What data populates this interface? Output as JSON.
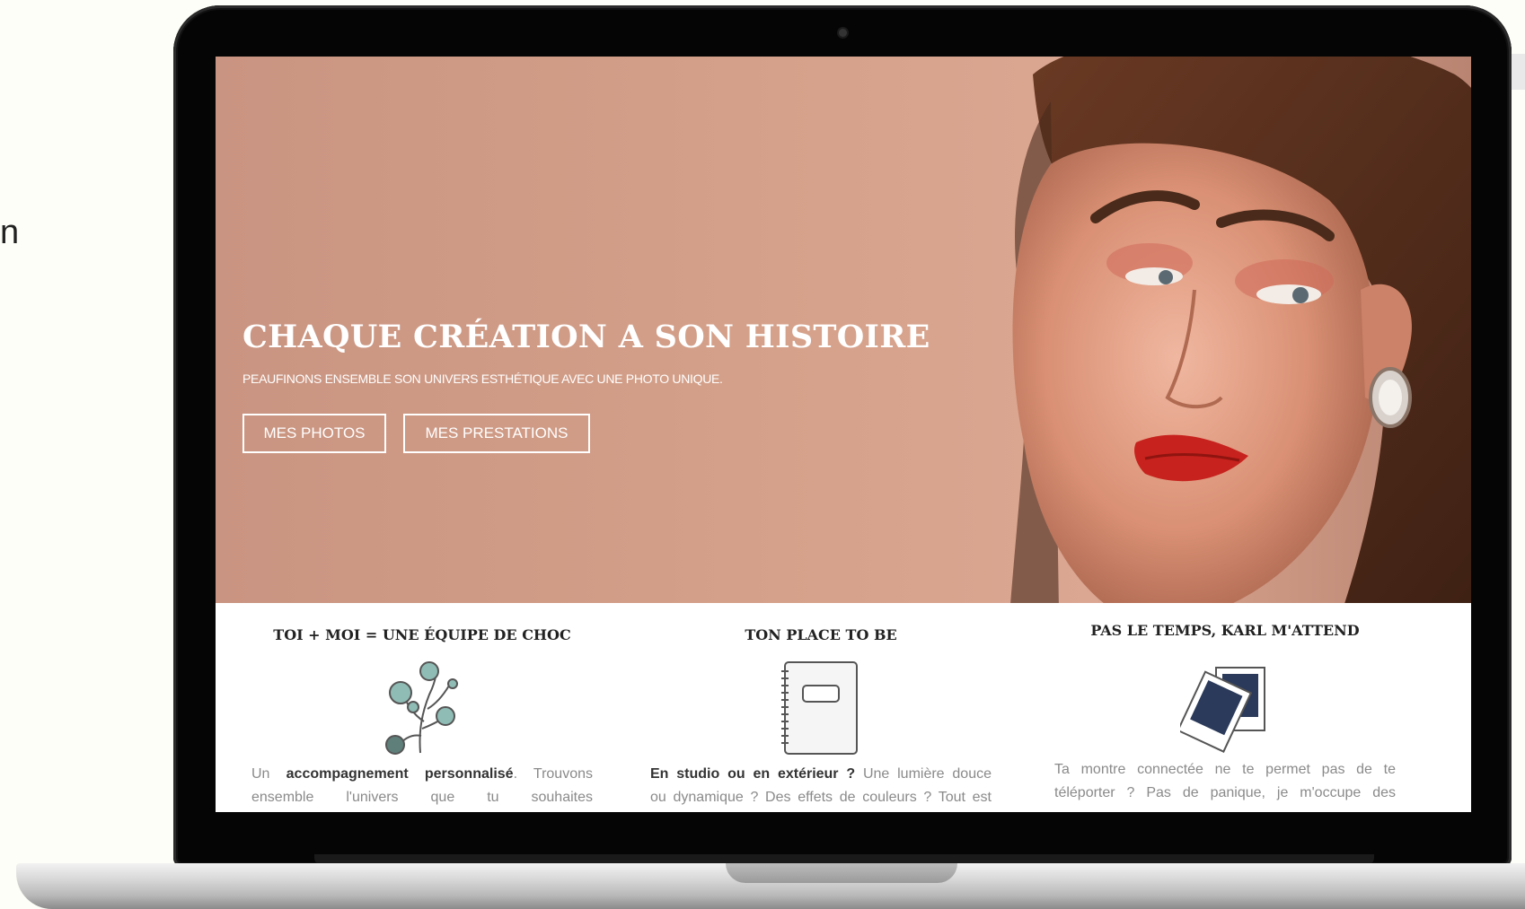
{
  "side": {
    "text": "n"
  },
  "hero": {
    "title": "CHAQUE CRÉATION A SON HISTOIRE",
    "subtitle": "PEAUFINONS ENSEMBLE SON UNIVERS ESTHÉTIQUE AVEC UNE PHOTO UNIQUE.",
    "buttons": [
      {
        "label": "MES PHOTOS"
      },
      {
        "label": "MES PRESTATIONS"
      }
    ]
  },
  "features": [
    {
      "title": "TOI + MOI = UNE ÉQUIPE DE CHOC",
      "icon": "eucalyptus-branch-icon",
      "text_bold_1": "accompagnement personnalisé",
      "text_pre": "Un ",
      "text_mid": ". Trouvons",
      "line2": "ensemble l'univers que tu souhaites"
    },
    {
      "title": "TON PLACE TO BE",
      "icon": "notebook-icon",
      "text_bold": "En studio ou en extérieur ?",
      "text_rest": " Une lumière douce",
      "line2": "ou dynamique ? Des effets de couleurs ? Tout est"
    },
    {
      "title": "PAS LE TEMPS, KARL M'ATTEND",
      "icon": "polaroid-photos-icon",
      "line1": "Ta montre connectée ne te permet pas de te",
      "line2": "téléporter ? Pas de panique, je m'occupe des"
    }
  ],
  "colors": {
    "hero_bg": "#d5a18a",
    "lip_red": "#c7221d",
    "icon_teal": "#8fbcb5",
    "icon_navy": "#2b3a5a"
  }
}
